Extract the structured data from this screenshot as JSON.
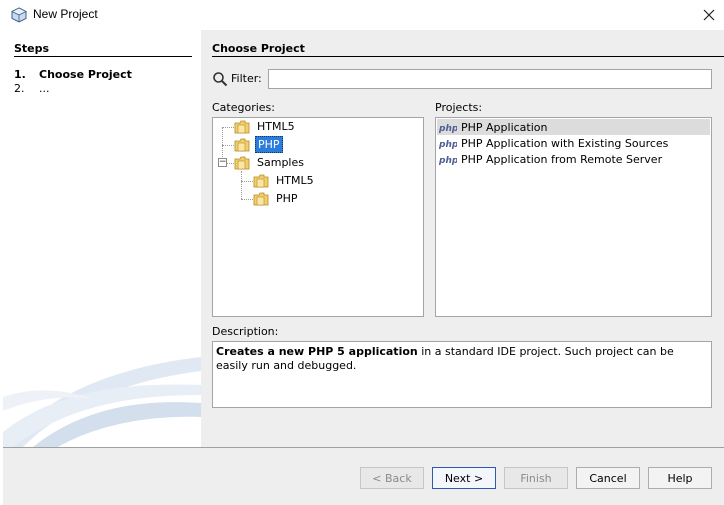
{
  "window": {
    "title": "New Project",
    "close_icon": "close-icon"
  },
  "steps": {
    "heading": "Steps",
    "items": [
      {
        "num": "1.",
        "label": "Choose Project"
      },
      {
        "num": "2.",
        "label": "..."
      }
    ]
  },
  "main": {
    "title": "Choose Project",
    "filter": {
      "label": "Filter:",
      "value": "",
      "placeholder": ""
    },
    "categories_label": "Categories:",
    "projects_label": "Projects:",
    "categories": [
      {
        "label": "HTML5"
      },
      {
        "label": "PHP",
        "selected": true
      },
      {
        "label": "Samples",
        "expanded": true
      },
      {
        "label": "HTML5"
      },
      {
        "label": "PHP"
      }
    ],
    "projects": [
      {
        "label": "PHP Application",
        "selected": true
      },
      {
        "label": "PHP Application with Existing Sources"
      },
      {
        "label": "PHP Application from Remote Server"
      }
    ],
    "description_label": "Description:",
    "description_bold": "Creates a new PHP 5 application",
    "description_rest": " in a standard IDE project. Such project can be easily run and debugged."
  },
  "buttons": {
    "back": "< Back",
    "next": "Next >",
    "finish": "Finish",
    "cancel": "Cancel",
    "help": "Help"
  },
  "colors": {
    "selection": "#2b7cdb",
    "panel": "#eeeeee"
  }
}
